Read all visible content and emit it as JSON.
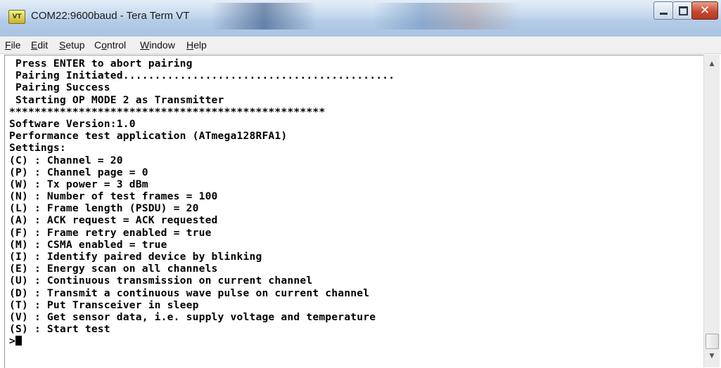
{
  "window": {
    "title": "COM22:9600baud - Tera Term VT",
    "app_icon_text": "VT",
    "controls": {
      "minimize": "minimize",
      "maximize": "maximize",
      "close": "✕"
    }
  },
  "menu": [
    {
      "label": "File",
      "accel": "F",
      "rest": "ile"
    },
    {
      "label": "Edit",
      "accel": "E",
      "rest": "dit"
    },
    {
      "label": "Setup",
      "accel": "S",
      "rest": "etup"
    },
    {
      "label": "Control",
      "accel": "o",
      "pre": "C",
      "rest": "ntrol"
    },
    {
      "label": "Window",
      "accel": "W",
      "rest": "indow"
    },
    {
      "label": "Help",
      "accel": "H",
      "rest": "elp"
    }
  ],
  "terminal": {
    "lines": [
      " Press ENTER to abort pairing",
      " Pairing Initiated...........................................",
      " Pairing Success",
      " Starting OP MODE 2 as Transmitter",
      "**************************************************",
      "Software Version:1.0",
      "Performance test application (ATmega128RFA1)",
      "Settings:",
      "(C) : Channel = 20",
      "(P) : Channel page = 0",
      "(W) : Tx power = 3 dBm",
      "(N) : Number of test frames = 100",
      "(L) : Frame length (PSDU) = 20",
      "(A) : ACK request = ACK requested",
      "(F) : Frame retry enabled = true",
      "(M) : CSMA enabled = true",
      "(I) : Identify paired device by blinking",
      "(E) : Energy scan on all channels",
      "(U) : Continuous transmission on current channel",
      "(D) : Transmit a continuous wave pulse on current channel",
      "(T) : Put Transceiver in sleep",
      "(V) : Get sensor data, i.e. supply voltage and temperature",
      "(S) : Start test"
    ],
    "prompt": ">"
  },
  "scrollbar": {
    "up_arrow": "▲",
    "down_arrow": "▼"
  }
}
